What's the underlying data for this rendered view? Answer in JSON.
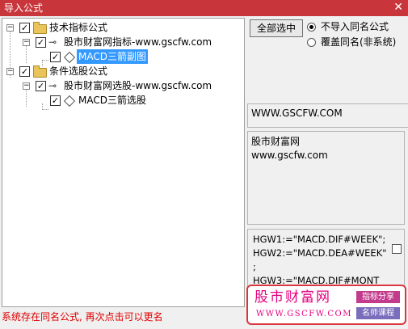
{
  "window": {
    "title": "导入公式",
    "close_glyph": "✕"
  },
  "tree": {
    "nodes": [
      {
        "label": "技术指标公式",
        "expander": "−",
        "checked": "✓",
        "icon": "folder-icon"
      },
      {
        "label": "股市财富网指标-www.gscfw.com",
        "expander": "−",
        "checked": "✓",
        "icon": "key-icon"
      },
      {
        "label": "MACD三箭副图",
        "checked": "✓",
        "icon": "formula-icon",
        "selected": true
      },
      {
        "label": "条件选股公式",
        "expander": "−",
        "checked": "✓",
        "icon": "folder-icon"
      },
      {
        "label": "股市财富网选股-www.gscfw.com",
        "expander": "−",
        "checked": "✓",
        "icon": "key-icon"
      },
      {
        "label": "MACD三箭选股",
        "checked": "✓",
        "icon": "formula-icon"
      }
    ]
  },
  "right_panel": {
    "select_all_label": "全部选中",
    "radio_options": [
      {
        "label": "不导入同名公式",
        "selected": true
      },
      {
        "label": "覆盖同名(非系统)",
        "selected": false
      }
    ],
    "url_text": "WWW.GSCFW.COM",
    "description_lines": [
      "股市财富网",
      "www.gscfw.com"
    ],
    "code_text": "HGW1:=\"MACD.DIF#WEEK\";\nHGW2:=\"MACD.DEA#WEEK\"\n;\nHGW3:=\"MACD.DIF#MONT"
  },
  "watermark": {
    "name": "股市财富网",
    "url": "WWW.GSCFW.COM",
    "tag1": "指标分享",
    "tag2": "名师课程"
  },
  "status_text": "系统存在同名公式, 再次点击可以更名",
  "colors": {
    "titlebar": "#c8353b",
    "selection": "#3399ff",
    "status": "#e00000",
    "watermark_text": "#e4007f"
  }
}
